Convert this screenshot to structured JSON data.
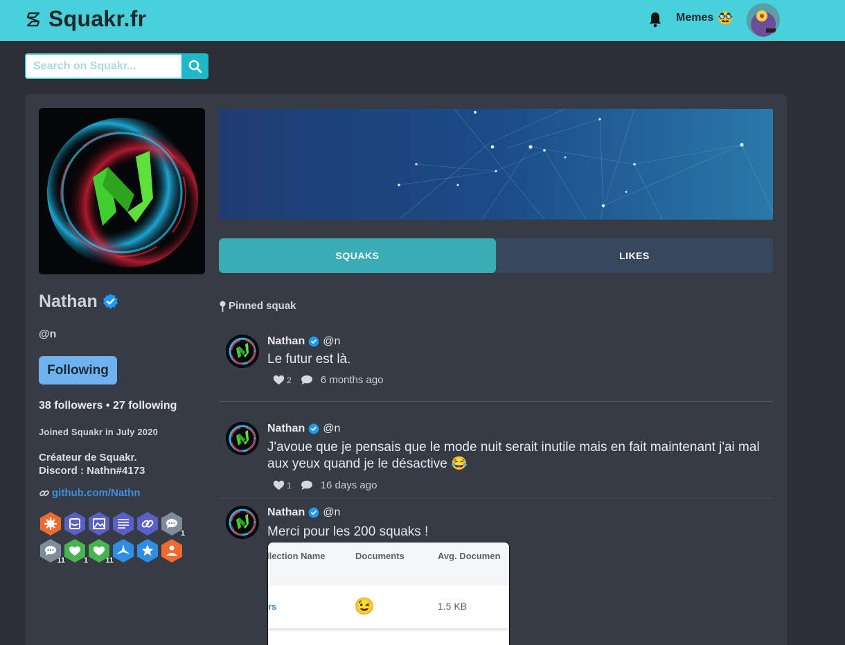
{
  "nav": {
    "brand": "Squakr.fr",
    "memes_label": "Memes",
    "memes_emoji": "🥸"
  },
  "search": {
    "placeholder": "Search on Squakr..."
  },
  "profile": {
    "name": "Nathan",
    "handle": "@n",
    "follow_label": "Following",
    "stats": "38 followers • 27 following",
    "joined": "Joined Squakr in July 2020",
    "bio_line1": "Créateur de Squakr.",
    "bio_line2": "Discord : Nathn#4173",
    "link": "github.com/Nathn",
    "badges": [
      {
        "icon": "gear-badge",
        "color": "#f06a2f"
      },
      {
        "icon": "cat-badge",
        "color": "#5a5fc7"
      },
      {
        "icon": "image-badge",
        "color": "#5a5fc7"
      },
      {
        "icon": "text-badge",
        "color": "#5a5fc7"
      },
      {
        "icon": "link-badge",
        "color": "#5a5fc7"
      },
      {
        "icon": "comment-badge",
        "color": "#7f8c99",
        "count": "1"
      },
      {
        "icon": "comment-badge",
        "color": "#7f8c99",
        "count": "11"
      },
      {
        "icon": "heart-badge",
        "color": "#47b54f",
        "count": "1"
      },
      {
        "icon": "heart-badge",
        "color": "#47b54f",
        "count": "11"
      },
      {
        "icon": "plane-badge",
        "color": "#2f8de4"
      },
      {
        "icon": "star-badge",
        "color": "#2f8de4"
      },
      {
        "icon": "user-check-badge",
        "color": "#f06a2f"
      }
    ]
  },
  "tabs": {
    "squaks": "SQUAKS",
    "likes": "LIKES"
  },
  "pinned_label": "Pinned squak",
  "posts": [
    {
      "name": "Nathan",
      "handle": "@n",
      "text": "Le futur est là.",
      "likes": "2",
      "time": "6 months ago"
    },
    {
      "name": "Nathan",
      "handle": "@n",
      "text": "J'avoue que je pensais que le mode nuit serait inutile mais en fait maintenant j'ai mal aux yeux quand je le désactive 😂",
      "likes": "1",
      "time": "16 days ago"
    },
    {
      "name": "Nathan",
      "handle": "@n",
      "text": "Merci pour les 200 squaks !"
    }
  ],
  "post_image": {
    "col1": "llection Name",
    "col2": "Documents",
    "col3": "Avg. Documen",
    "cell1": "rs",
    "cell2": "😉",
    "cell3": "1.5 KB"
  },
  "colors": {
    "accent": "#48d1da",
    "tab_active": "#3aacb5",
    "link": "#3d8fe0",
    "follow": "#6fb2f0"
  }
}
